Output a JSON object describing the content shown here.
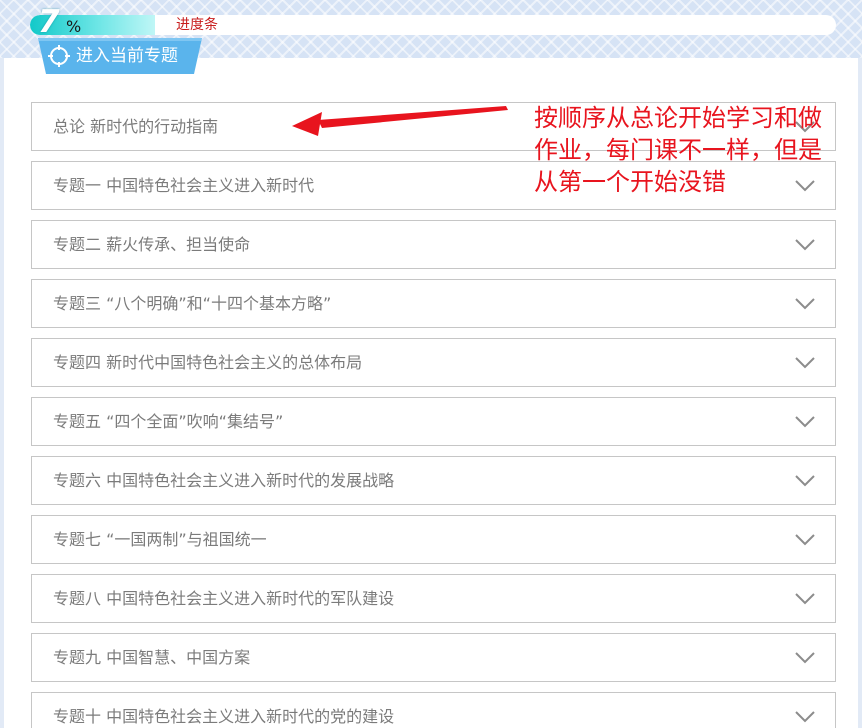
{
  "progress": {
    "value": 7,
    "percent_fill": 7,
    "unit": "%",
    "label": "进度条"
  },
  "section": {
    "title": "进入当前专题",
    "icon": "crosshair-icon"
  },
  "topics": [
    {
      "label": "总论 新时代的行动指南"
    },
    {
      "label": "专题一 中国特色社会主义进入新时代"
    },
    {
      "label": "专题二 薪火传承、担当使命"
    },
    {
      "label": "专题三 “八个明确”和“十四个基本方略”"
    },
    {
      "label": "专题四 新时代中国特色社会主义的总体布局"
    },
    {
      "label": "专题五 “四个全面”吹响“集结号”"
    },
    {
      "label": "专题六 中国特色社会主义进入新时代的发展战略"
    },
    {
      "label": "专题七 “一国两制”与祖国统一"
    },
    {
      "label": "专题八 中国特色社会主义进入新时代的军队建设"
    },
    {
      "label": "专题九 中国智慧、中国方案"
    },
    {
      "label": "专题十 中国特色社会主义进入新时代的党的建设"
    }
  ],
  "annotation": {
    "lines": [
      "按顺序从总论开始学习和做",
      "作业，每门课不一样，但是",
      "从第一个开始没错"
    ],
    "color": "#e8141e"
  },
  "colors": {
    "accent": "#12c9c9",
    "tab": "#5ab4ec",
    "border": "#c6c6c6",
    "label_text": "#7b7b7b",
    "progress_label": "#c81e1e"
  }
}
